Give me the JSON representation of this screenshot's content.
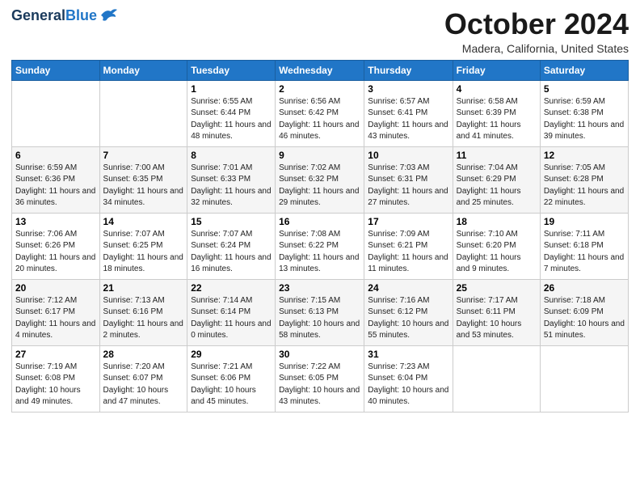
{
  "logo": {
    "line1": "General",
    "line2": "Blue"
  },
  "title": "October 2024",
  "location": "Madera, California, United States",
  "weekdays": [
    "Sunday",
    "Monday",
    "Tuesday",
    "Wednesday",
    "Thursday",
    "Friday",
    "Saturday"
  ],
  "weeks": [
    [
      null,
      null,
      {
        "day": "1",
        "sunrise": "6:55 AM",
        "sunset": "6:44 PM",
        "daylight": "11 hours and 48 minutes."
      },
      {
        "day": "2",
        "sunrise": "6:56 AM",
        "sunset": "6:42 PM",
        "daylight": "11 hours and 46 minutes."
      },
      {
        "day": "3",
        "sunrise": "6:57 AM",
        "sunset": "6:41 PM",
        "daylight": "11 hours and 43 minutes."
      },
      {
        "day": "4",
        "sunrise": "6:58 AM",
        "sunset": "6:39 PM",
        "daylight": "11 hours and 41 minutes."
      },
      {
        "day": "5",
        "sunrise": "6:59 AM",
        "sunset": "6:38 PM",
        "daylight": "11 hours and 39 minutes."
      }
    ],
    [
      {
        "day": "6",
        "sunrise": "6:59 AM",
        "sunset": "6:36 PM",
        "daylight": "11 hours and 36 minutes."
      },
      {
        "day": "7",
        "sunrise": "7:00 AM",
        "sunset": "6:35 PM",
        "daylight": "11 hours and 34 minutes."
      },
      {
        "day": "8",
        "sunrise": "7:01 AM",
        "sunset": "6:33 PM",
        "daylight": "11 hours and 32 minutes."
      },
      {
        "day": "9",
        "sunrise": "7:02 AM",
        "sunset": "6:32 PM",
        "daylight": "11 hours and 29 minutes."
      },
      {
        "day": "10",
        "sunrise": "7:03 AM",
        "sunset": "6:31 PM",
        "daylight": "11 hours and 27 minutes."
      },
      {
        "day": "11",
        "sunrise": "7:04 AM",
        "sunset": "6:29 PM",
        "daylight": "11 hours and 25 minutes."
      },
      {
        "day": "12",
        "sunrise": "7:05 AM",
        "sunset": "6:28 PM",
        "daylight": "11 hours and 22 minutes."
      }
    ],
    [
      {
        "day": "13",
        "sunrise": "7:06 AM",
        "sunset": "6:26 PM",
        "daylight": "11 hours and 20 minutes."
      },
      {
        "day": "14",
        "sunrise": "7:07 AM",
        "sunset": "6:25 PM",
        "daylight": "11 hours and 18 minutes."
      },
      {
        "day": "15",
        "sunrise": "7:07 AM",
        "sunset": "6:24 PM",
        "daylight": "11 hours and 16 minutes."
      },
      {
        "day": "16",
        "sunrise": "7:08 AM",
        "sunset": "6:22 PM",
        "daylight": "11 hours and 13 minutes."
      },
      {
        "day": "17",
        "sunrise": "7:09 AM",
        "sunset": "6:21 PM",
        "daylight": "11 hours and 11 minutes."
      },
      {
        "day": "18",
        "sunrise": "7:10 AM",
        "sunset": "6:20 PM",
        "daylight": "11 hours and 9 minutes."
      },
      {
        "day": "19",
        "sunrise": "7:11 AM",
        "sunset": "6:18 PM",
        "daylight": "11 hours and 7 minutes."
      }
    ],
    [
      {
        "day": "20",
        "sunrise": "7:12 AM",
        "sunset": "6:17 PM",
        "daylight": "11 hours and 4 minutes."
      },
      {
        "day": "21",
        "sunrise": "7:13 AM",
        "sunset": "6:16 PM",
        "daylight": "11 hours and 2 minutes."
      },
      {
        "day": "22",
        "sunrise": "7:14 AM",
        "sunset": "6:14 PM",
        "daylight": "11 hours and 0 minutes."
      },
      {
        "day": "23",
        "sunrise": "7:15 AM",
        "sunset": "6:13 PM",
        "daylight": "10 hours and 58 minutes."
      },
      {
        "day": "24",
        "sunrise": "7:16 AM",
        "sunset": "6:12 PM",
        "daylight": "10 hours and 55 minutes."
      },
      {
        "day": "25",
        "sunrise": "7:17 AM",
        "sunset": "6:11 PM",
        "daylight": "10 hours and 53 minutes."
      },
      {
        "day": "26",
        "sunrise": "7:18 AM",
        "sunset": "6:09 PM",
        "daylight": "10 hours and 51 minutes."
      }
    ],
    [
      {
        "day": "27",
        "sunrise": "7:19 AM",
        "sunset": "6:08 PM",
        "daylight": "10 hours and 49 minutes."
      },
      {
        "day": "28",
        "sunrise": "7:20 AM",
        "sunset": "6:07 PM",
        "daylight": "10 hours and 47 minutes."
      },
      {
        "day": "29",
        "sunrise": "7:21 AM",
        "sunset": "6:06 PM",
        "daylight": "10 hours and 45 minutes."
      },
      {
        "day": "30",
        "sunrise": "7:22 AM",
        "sunset": "6:05 PM",
        "daylight": "10 hours and 43 minutes."
      },
      {
        "day": "31",
        "sunrise": "7:23 AM",
        "sunset": "6:04 PM",
        "daylight": "10 hours and 40 minutes."
      },
      null,
      null
    ]
  ]
}
